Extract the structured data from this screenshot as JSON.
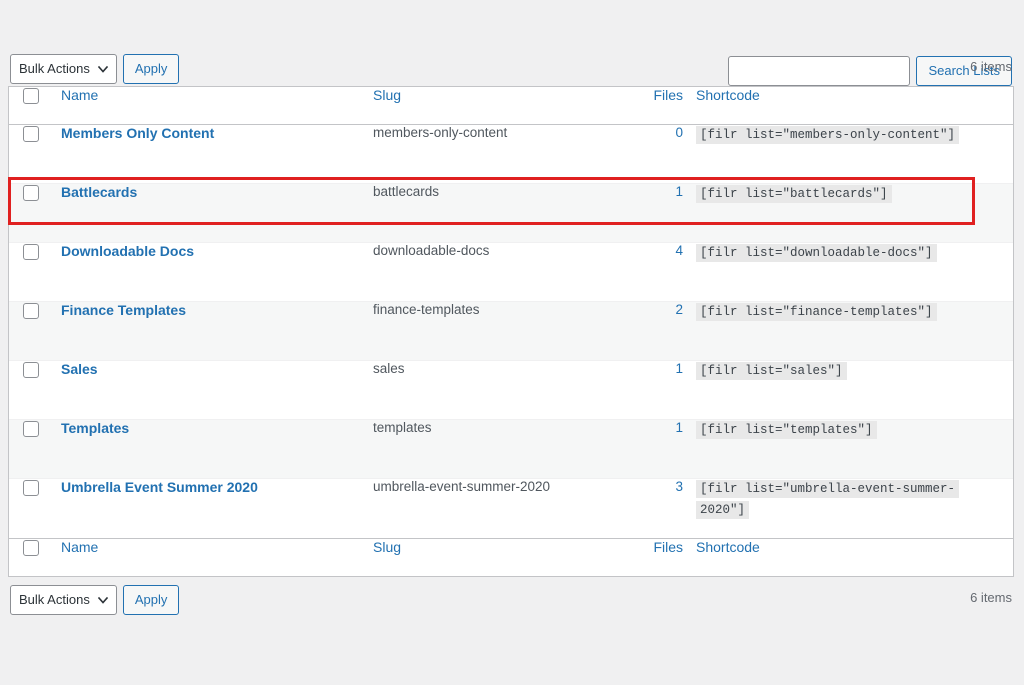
{
  "search": {
    "value": "",
    "placeholder": "",
    "button_label": "Search Lists"
  },
  "toolbar_top": {
    "bulk_actions_label": "Bulk Actions",
    "apply_label": "Apply",
    "items_count": "6 items"
  },
  "toolbar_bottom": {
    "bulk_actions_label": "Bulk Actions",
    "apply_label": "Apply",
    "items_count": "6 items"
  },
  "table": {
    "columns": {
      "name": "Name",
      "slug": "Slug",
      "files": "Files",
      "shortcode": "Shortcode"
    },
    "rows": [
      {
        "name": "Members Only Content",
        "slug": "members-only-content",
        "files": "0",
        "shortcode": "[filr list=\"members-only-content\"]"
      },
      {
        "name": "Battlecards",
        "slug": "battlecards",
        "files": "1",
        "shortcode": "[filr list=\"battlecards\"]"
      },
      {
        "name": "Downloadable Docs",
        "slug": "downloadable-docs",
        "files": "4",
        "shortcode": "[filr list=\"downloadable-docs\"]"
      },
      {
        "name": "Finance Templates",
        "slug": "finance-templates",
        "files": "2",
        "shortcode": "[filr list=\"finance-templates\"]"
      },
      {
        "name": "Sales",
        "slug": "sales",
        "files": "1",
        "shortcode": "[filr list=\"sales\"]"
      },
      {
        "name": "Templates",
        "slug": "templates",
        "files": "1",
        "shortcode": "[filr list=\"templates\"]"
      },
      {
        "name": "Umbrella Event Summer 2020",
        "slug": "umbrella-event-summer-2020",
        "files": "3",
        "shortcode": "[filr list=\"umbrella-event-summer-2020\"]"
      }
    ]
  },
  "annotation": {
    "highlight_color": "#e02020",
    "highlighted_row": "Members Only Content"
  },
  "colors": {
    "link": "#2271b1",
    "page_background": "#f0f0f1",
    "row_alt": "#f6f7f7",
    "border": "#c3c4c7",
    "muted_text": "#646970"
  }
}
